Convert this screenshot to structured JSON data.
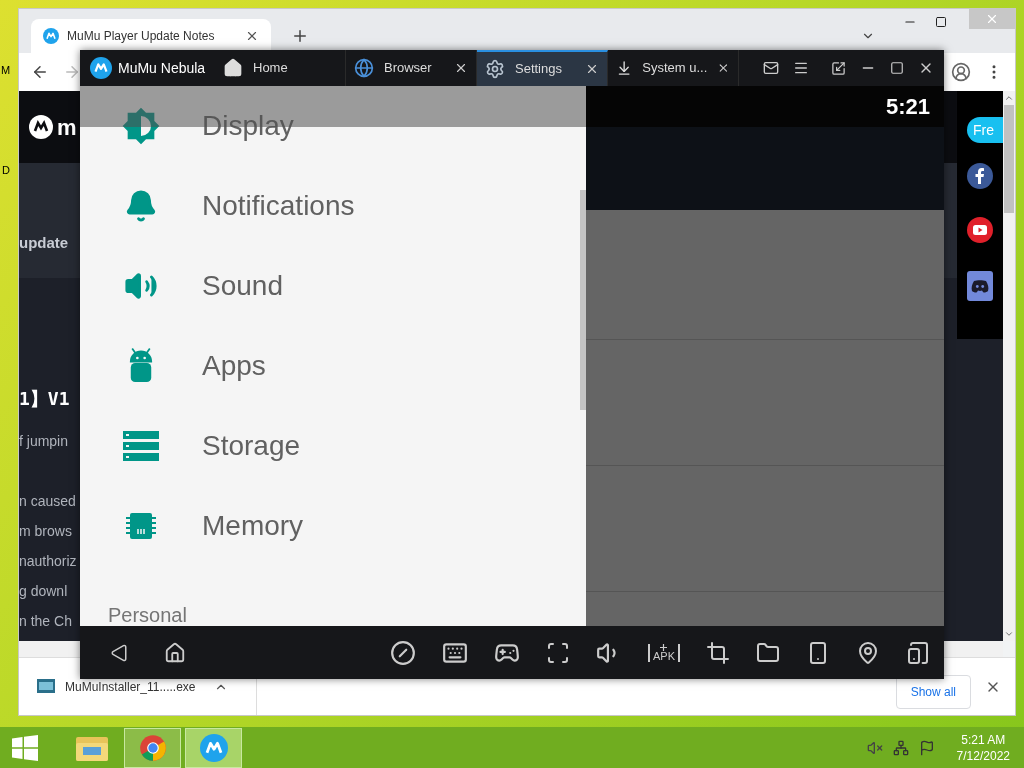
{
  "desktop": {
    "edge_labels": [
      "M",
      "D"
    ]
  },
  "browser": {
    "tab_title": "MuMu Player Update Notes",
    "forward_disabled": true,
    "page": {
      "logo_text": "m",
      "subnav_text": "update",
      "heading": "1】V1",
      "lines": [
        "f jumpin",
        "n caused",
        "m brows",
        "nauthoriz",
        "g downl",
        "n the Ch"
      ],
      "cta": "Fre"
    },
    "downloads": {
      "file": "MuMuInstaller_11.....exe",
      "show_all": "Show all"
    }
  },
  "emulator": {
    "brand": "MuMu Nebula",
    "tabs": [
      {
        "label": "Home",
        "kind": "home",
        "closable": false,
        "selected": false
      },
      {
        "label": "Browser",
        "kind": "browser",
        "closable": true,
        "selected": false
      },
      {
        "label": "Settings",
        "kind": "settings",
        "closable": true,
        "selected": true
      },
      {
        "label": "System u...",
        "kind": "download",
        "closable": true,
        "selected": false
      }
    ],
    "clock": "5:21",
    "drawer": {
      "items": [
        {
          "label": "Display",
          "kind": "display"
        },
        {
          "label": "Notifications",
          "kind": "notifications"
        },
        {
          "label": "Sound",
          "kind": "sound"
        },
        {
          "label": "Apps",
          "kind": "apps"
        },
        {
          "label": "Storage",
          "kind": "storage"
        },
        {
          "label": "Memory",
          "kind": "memory"
        }
      ],
      "section": "Personal"
    },
    "apk_label": "APK"
  },
  "taskbar": {
    "apps": [
      {
        "kind": "explorer",
        "running": false,
        "selected": false
      },
      {
        "kind": "chrome",
        "running": true,
        "selected": false
      },
      {
        "kind": "mumu",
        "running": true,
        "selected": true
      }
    ],
    "time": "5:21 AM",
    "date": "7/12/2022"
  }
}
